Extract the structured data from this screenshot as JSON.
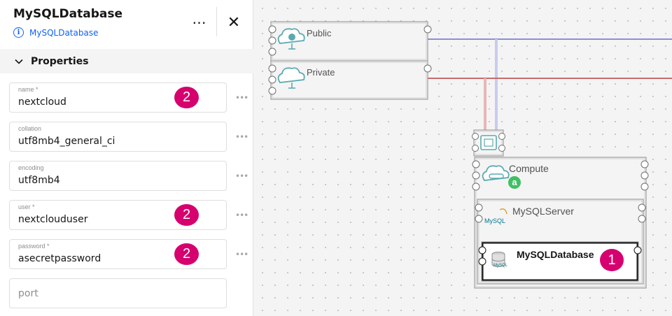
{
  "panel": {
    "title": "MySQLDatabase",
    "subtitle": "MySQLDatabase",
    "more_icon": "⋯",
    "close_icon": "✕",
    "section_label": "Properties",
    "menu_icon": "•••",
    "fields": [
      {
        "label": "name *",
        "value": "nextcloud",
        "badge": "2"
      },
      {
        "label": "collation",
        "value": "utf8mb4_general_ci",
        "badge": ""
      },
      {
        "label": "encoding",
        "value": "utf8mb4",
        "badge": ""
      },
      {
        "label": "user *",
        "value": "nextclouduser",
        "badge": "2"
      },
      {
        "label": "password *",
        "value": "asecretpassword",
        "badge": "2"
      },
      {
        "label": "",
        "value": "",
        "placeholder": "port",
        "badge": ""
      }
    ]
  },
  "canvas": {
    "nodes": {
      "public": "Public",
      "private": "Private",
      "compute": "Compute",
      "mysql_server": "MySQLServer",
      "mysql_logo": "MySQL",
      "mysql_database": "MySQLDatabase"
    },
    "compute_badge": "a",
    "database_badge": "1"
  },
  "colors": {
    "accent": "#0f62fe",
    "badge": "#d6006e",
    "green_badge": "#42be65",
    "public_line": "#8a8fd6",
    "private_line": "#c86b6b"
  }
}
